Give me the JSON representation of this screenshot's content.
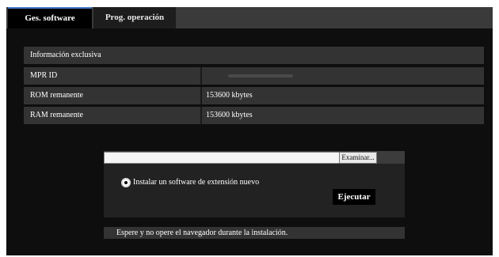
{
  "tabs": [
    {
      "label": "Ges. software"
    },
    {
      "label": "Prog. operación"
    }
  ],
  "info_table": {
    "header": "Información exclusiva",
    "rows": [
      {
        "key": "MPR ID",
        "value": ""
      },
      {
        "key": "ROM remanente",
        "value": "153600 kbytes"
      },
      {
        "key": "RAM remanente",
        "value": "153600 kbytes"
      }
    ]
  },
  "upload": {
    "file_value": "",
    "browse_label": "Examinar...",
    "option_label": "Instalar un software de extensión nuevo",
    "run_label": "Ejecutar"
  },
  "notice": "Espere y no opere el navegador durante la instalación."
}
